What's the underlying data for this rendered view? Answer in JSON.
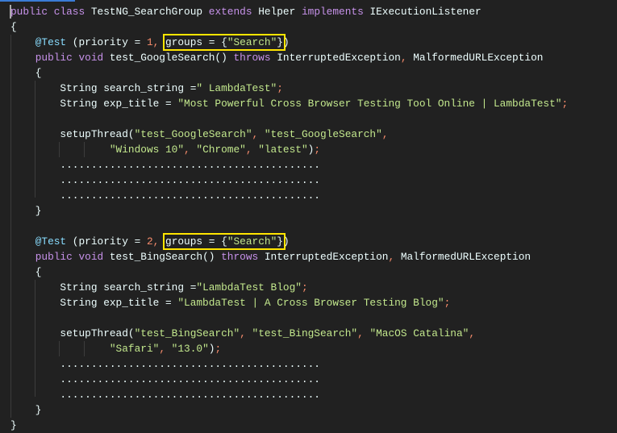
{
  "colors": {
    "keyword": "#c792ea",
    "string": "#c3e88d",
    "number": "#f78c6c",
    "annotation": "#89ddff",
    "highlight": "#ffe500"
  },
  "lines": [
    [
      [
        "public class ",
        "k"
      ],
      [
        "TestNG_SearchGroup ",
        "t"
      ],
      [
        "extends ",
        "k"
      ],
      [
        "Helper ",
        "t"
      ],
      [
        "implements ",
        "k"
      ],
      [
        "IExecutionListener",
        "t"
      ]
    ],
    [
      [
        "{",
        "t"
      ]
    ],
    [
      [
        "    ",
        "t"
      ],
      [
        "@Test",
        "a"
      ],
      [
        " (priority = ",
        "t"
      ],
      [
        "1",
        "n"
      ],
      [
        ", ",
        "p"
      ],
      [
        "groups = {",
        "t",
        "hl1"
      ],
      [
        "\"Search\"",
        "s",
        "hl1"
      ],
      [
        "}",
        "t",
        "hl1"
      ],
      [
        ")",
        "t"
      ]
    ],
    [
      [
        "    ",
        "t"
      ],
      [
        "public void ",
        "k"
      ],
      [
        "test_GoogleSearch() ",
        "t"
      ],
      [
        "throws ",
        "k"
      ],
      [
        "InterruptedException",
        "t"
      ],
      [
        ", ",
        "p"
      ],
      [
        "MalformedURLException",
        "t"
      ]
    ],
    [
      [
        "    {",
        "t"
      ]
    ],
    [
      [
        "        String search_string =",
        "t"
      ],
      [
        "\" LambdaTest\"",
        "s"
      ],
      [
        ";",
        "p"
      ]
    ],
    [
      [
        "        String exp_title = ",
        "t"
      ],
      [
        "\"Most Powerful Cross Browser Testing Tool Online | LambdaTest\"",
        "s"
      ],
      [
        ";",
        "p"
      ]
    ],
    [
      [
        "",
        "t"
      ]
    ],
    [
      [
        "        setupThread(",
        "t"
      ],
      [
        "\"test_GoogleSearch\"",
        "s"
      ],
      [
        ", ",
        "p"
      ],
      [
        "\"test_GoogleSearch\"",
        "s"
      ],
      [
        ",",
        "p"
      ]
    ],
    [
      [
        "                ",
        "t"
      ],
      [
        "\"Windows 10\"",
        "s"
      ],
      [
        ", ",
        "p"
      ],
      [
        "\"Chrome\"",
        "s"
      ],
      [
        ", ",
        "p"
      ],
      [
        "\"latest\"",
        "s"
      ],
      [
        ")",
        "t"
      ],
      [
        ";",
        "p"
      ]
    ],
    [
      [
        "        ..........................................",
        "t"
      ]
    ],
    [
      [
        "        ..........................................",
        "t"
      ]
    ],
    [
      [
        "        ..........................................",
        "t"
      ]
    ],
    [
      [
        "    }",
        "t"
      ]
    ],
    [
      [
        "",
        "t"
      ]
    ],
    [
      [
        "    ",
        "t"
      ],
      [
        "@Test",
        "a"
      ],
      [
        " (priority = ",
        "t"
      ],
      [
        "2",
        "n"
      ],
      [
        ", ",
        "p"
      ],
      [
        "groups = {",
        "t",
        "hl2"
      ],
      [
        "\"Search\"",
        "s",
        "hl2"
      ],
      [
        "}",
        "t",
        "hl2"
      ],
      [
        ")",
        "t"
      ]
    ],
    [
      [
        "    ",
        "t"
      ],
      [
        "public void ",
        "k"
      ],
      [
        "test_BingSearch() ",
        "t"
      ],
      [
        "throws ",
        "k"
      ],
      [
        "InterruptedException",
        "t"
      ],
      [
        ", ",
        "p"
      ],
      [
        "MalformedURLException",
        "t"
      ]
    ],
    [
      [
        "    {",
        "t"
      ]
    ],
    [
      [
        "        String search_string =",
        "t"
      ],
      [
        "\"LambdaTest Blog\"",
        "s"
      ],
      [
        ";",
        "p"
      ]
    ],
    [
      [
        "        String exp_title = ",
        "t"
      ],
      [
        "\"LambdaTest | A Cross Browser Testing Blog\"",
        "s"
      ],
      [
        ";",
        "p"
      ]
    ],
    [
      [
        "",
        "t"
      ]
    ],
    [
      [
        "        setupThread(",
        "t"
      ],
      [
        "\"test_BingSearch\"",
        "s"
      ],
      [
        ", ",
        "p"
      ],
      [
        "\"test_BingSearch\"",
        "s"
      ],
      [
        ", ",
        "p"
      ],
      [
        "\"MacOS Catalina\"",
        "s"
      ],
      [
        ",",
        "p"
      ]
    ],
    [
      [
        "                ",
        "t"
      ],
      [
        "\"Safari\"",
        "s"
      ],
      [
        ", ",
        "p"
      ],
      [
        "\"13.0\"",
        "s"
      ],
      [
        ")",
        "t"
      ],
      [
        ";",
        "p"
      ]
    ],
    [
      [
        "        ..........................................",
        "t"
      ]
    ],
    [
      [
        "        ..........................................",
        "t"
      ]
    ],
    [
      [
        "        ..........................................",
        "t"
      ]
    ],
    [
      [
        "    }",
        "t"
      ]
    ],
    [
      [
        "}",
        "t"
      ]
    ]
  ]
}
